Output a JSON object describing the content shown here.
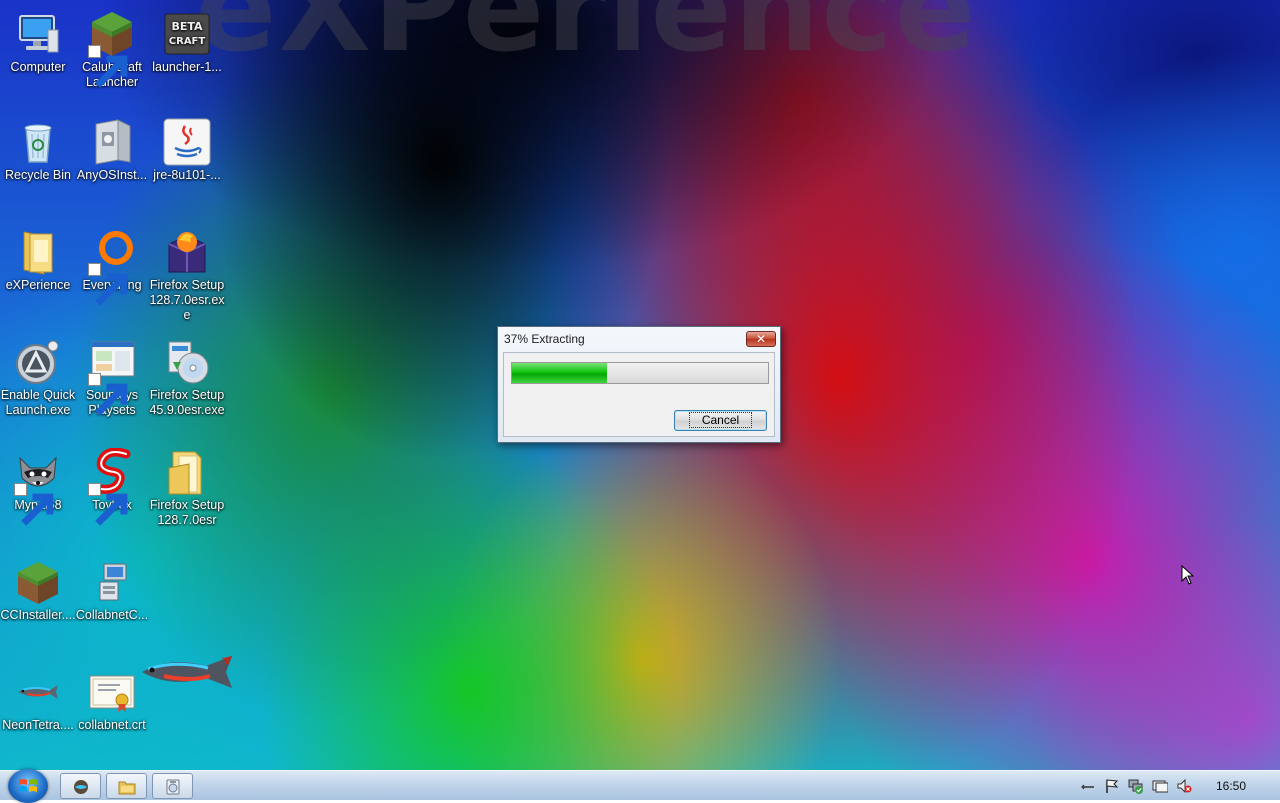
{
  "desktop": {
    "icons": [
      {
        "label": "Computer",
        "icon": "computer-icon"
      },
      {
        "label": "CalubCraft Launcher",
        "icon": "minecraft-grass-block-icon"
      },
      {
        "label": "launcher-1...",
        "icon": "beta-craft-icon"
      },
      {
        "label": "Recycle Bin",
        "icon": "recycle-bin-icon"
      },
      {
        "label": "AnyOSInst...",
        "icon": "installer-package-icon"
      },
      {
        "label": "jre-8u101-...",
        "icon": "java-icon"
      },
      {
        "label": "eXPerience",
        "icon": "folder-icon"
      },
      {
        "label": "Everything",
        "icon": "everything-search-icon"
      },
      {
        "label": "Firefox Setup 128.7.0esr.exe",
        "icon": "firefox-setup-icon"
      },
      {
        "label": "Enable Quick Launch.exe",
        "icon": "quick-launch-icon"
      },
      {
        "label": "Souptoys Playsets",
        "icon": "souptoys-icon"
      },
      {
        "label": "Firefox Setup 45.9.0esr.exe",
        "icon": "setup-disc-icon"
      },
      {
        "label": "Mypal68",
        "icon": "raccoon-icon"
      },
      {
        "label": "Toybox",
        "icon": "toybox-icon"
      },
      {
        "label": "Firefox Setup 128.7.0esr",
        "icon": "folder-open-icon"
      },
      {
        "label": "CCInstaller....",
        "icon": "minecraft-grass-block-icon"
      },
      {
        "label": "CollabnetC...",
        "icon": "network-computer-icon"
      },
      {
        "label": "NeonTetra....",
        "icon": "fish-icon"
      },
      {
        "label": "collabnet.crt",
        "icon": "certificate-icon"
      }
    ]
  },
  "dialog": {
    "title": "37% Extracting",
    "progress": 0.37,
    "cancel_label": "Cancel",
    "close_glyph": "✕"
  },
  "taskbar": {
    "clock": "16:50",
    "buttons": [
      "neon-tetra-app-icon",
      "folder-icon",
      "extractor-icon"
    ],
    "tray": [
      "show-hidden-icon",
      "action-center-flag-icon",
      "network-icon",
      "display-icon",
      "volume-muted-icon"
    ]
  },
  "colors": {
    "progress_fill": "#11c511",
    "close_button": "#c24a32",
    "taskbar": "#c3d6ea"
  }
}
